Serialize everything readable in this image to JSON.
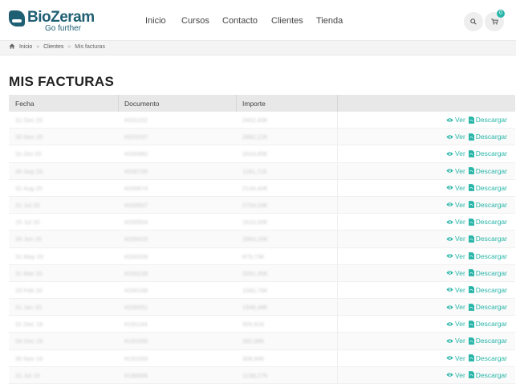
{
  "brand": {
    "name": "BioZeram",
    "tagline": "Go further",
    "color": "#1f5f73"
  },
  "nav": [
    {
      "id": "inicio",
      "label": "Inicio"
    },
    {
      "id": "cursos",
      "label": "Cursos"
    },
    {
      "id": "contacto",
      "label": "Contacto"
    },
    {
      "id": "clientes",
      "label": "Clientes"
    },
    {
      "id": "tienda",
      "label": "Tienda"
    }
  ],
  "header_icons": {
    "search": "search-icon",
    "cart": "cart-icon",
    "cart_count": "0"
  },
  "breadcrumb": {
    "home_icon": "home-icon",
    "items": [
      "Inicio",
      "Clientes",
      "Mis facturas"
    ],
    "separator": "»"
  },
  "page": {
    "title": "MIS FACTURAS"
  },
  "table": {
    "columns": [
      "Fecha",
      "Documento",
      "Importe",
      ""
    ],
    "rows": [
      {
        "date": "31 Dec 20",
        "doc": "#201102",
        "amount": "2402,40€"
      },
      {
        "date": "30 Nov 20",
        "doc": "#201037",
        "amount": "2882,22€"
      },
      {
        "date": "31 Oct 20",
        "doc": "#200960",
        "amount": "2024,85€"
      },
      {
        "date": "30 Sep 20",
        "doc": "#200795",
        "amount": "1181,71€"
      },
      {
        "date": "31 Aug 20",
        "doc": "#200674",
        "amount": "2144,40€"
      },
      {
        "date": "31 Jul 20",
        "doc": "#200507",
        "amount": "2754,03€"
      },
      {
        "date": "15 Jul 20",
        "doc": "#200504",
        "amount": "1610,55€"
      },
      {
        "date": "30 Jun 20",
        "doc": "#200415",
        "amount": "2963,20€"
      },
      {
        "date": "31 May 20",
        "doc": "#200339",
        "amount": "679,73€"
      },
      {
        "date": "31 Mar 20",
        "doc": "#200239",
        "amount": "2051,30€"
      },
      {
        "date": "29 Feb 20",
        "doc": "#200168",
        "amount": "1082,76€"
      },
      {
        "date": "31 Jan 20",
        "doc": "#200051",
        "amount": "1946,48€"
      },
      {
        "date": "31 Dec 19",
        "doc": "#191144",
        "amount": "505,61€"
      },
      {
        "date": "04 Dec 19",
        "doc": "#191055",
        "amount": "382,98€"
      },
      {
        "date": "30 Nov 19",
        "doc": "#191033",
        "amount": "308,94€"
      },
      {
        "date": "31 Jul 19",
        "doc": "#190606",
        "amount": "1238,27€"
      }
    ],
    "action_view": "Ver",
    "action_download": "Descargar",
    "action_color": "#28b5a8"
  }
}
